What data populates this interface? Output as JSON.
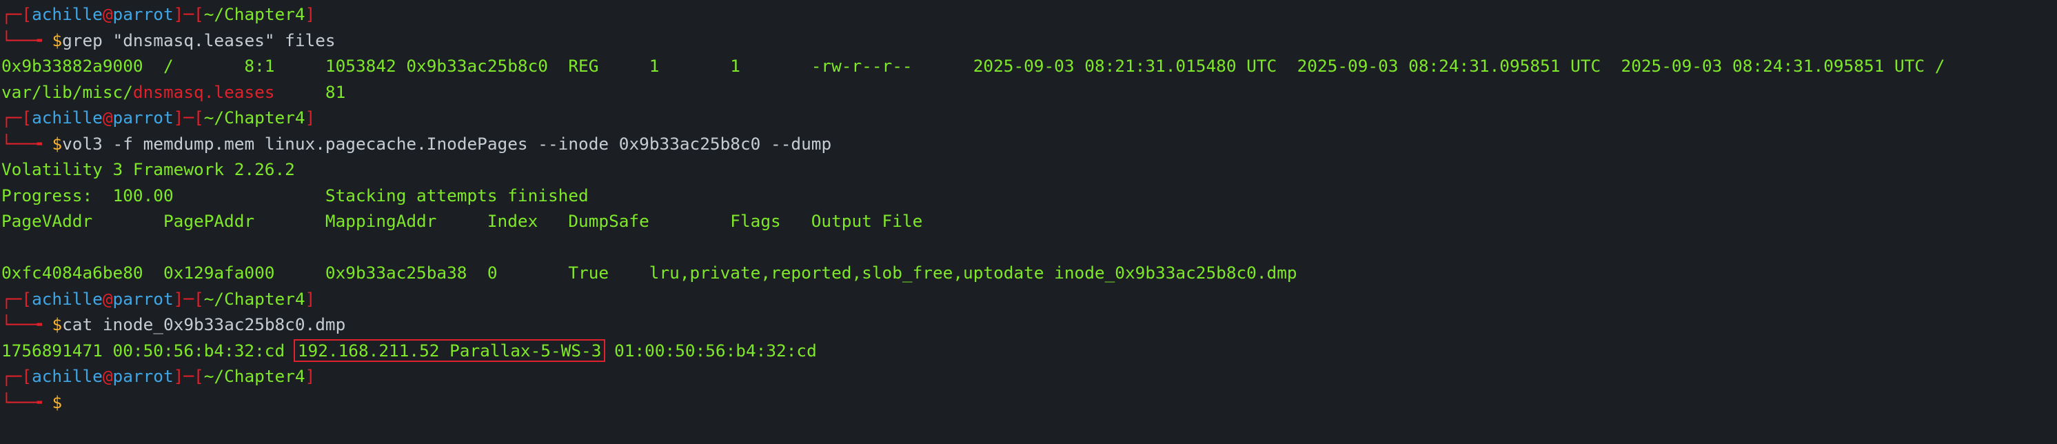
{
  "prompt": {
    "user": "achille",
    "at": "@",
    "host": "parrot",
    "path": "~/Chapter4",
    "symbol": "$"
  },
  "blocks": [
    {
      "command": "grep \"dnsmasq.leases\" files",
      "output_1": "0x9b33882a9000  /       8:1     1053842 0x9b33ac25b8c0  REG     1       1       -rw-r--r--      2025-09-03 08:21:31.015480 UTC  2025-09-03 08:24:31.095851 UTC  2025-09-03 08:24:31.095851 UTC /",
      "output_2_prefix": "var/lib/misc/",
      "output_2_file": "dnsmasq.leases",
      "output_2_suffix": "     81"
    },
    {
      "command": "vol3 -f memdump.mem linux.pagecache.InodePages --inode 0x9b33ac25b8c0 --dump",
      "lines": [
        "Volatility 3 Framework 2.26.2",
        "Progress:  100.00               Stacking attempts finished",
        "PageVAddr       PagePAddr       MappingAddr     Index   DumpSafe        Flags   Output File",
        "",
        "0xfc4084a6be80  0x129afa000     0x9b33ac25ba38  0       True    lru,private,reported,slob_free,uptodate inode_0x9b33ac25b8c0.dmp"
      ]
    },
    {
      "command": "cat inode_0x9b33ac25b8c0.dmp",
      "out_prefix": "1756891471 00:50:56:b4:32:cd ",
      "out_highlight": "192.168.211.52 Parallax-5-WS-3",
      "out_suffix": " 01:00:50:56:b4:32:cd"
    }
  ],
  "colors": {
    "background": "#1b1e22",
    "prompt_red": "#e0202a",
    "user_blue": "#3fa7e6",
    "output_green": "#7fe82a",
    "dollar_yellow": "#fbb32f",
    "text": "#c6cdd2",
    "highlight_box": "#e0202a"
  }
}
